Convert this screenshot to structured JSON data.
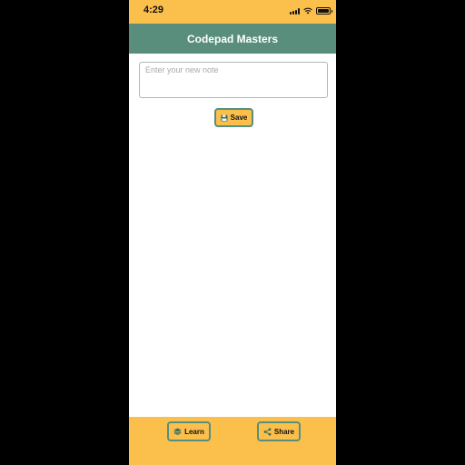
{
  "status_bar": {
    "time": "4:29",
    "icons": [
      "signal-icon",
      "wifi-icon",
      "battery-icon"
    ]
  },
  "header": {
    "title": "Codepad Masters"
  },
  "note_input": {
    "value": "",
    "placeholder": "Enter your new note"
  },
  "save_button": {
    "label": "Save",
    "icon": "floppy-disk-icon"
  },
  "footer": {
    "learn_label": "Learn",
    "learn_icon": "layers-icon",
    "share_label": "Share",
    "share_icon": "share-icon"
  },
  "colors": {
    "accent": "#fbbf4c",
    "header": "#5a8e7c",
    "background": "#ffffff",
    "frame": "#000000"
  }
}
